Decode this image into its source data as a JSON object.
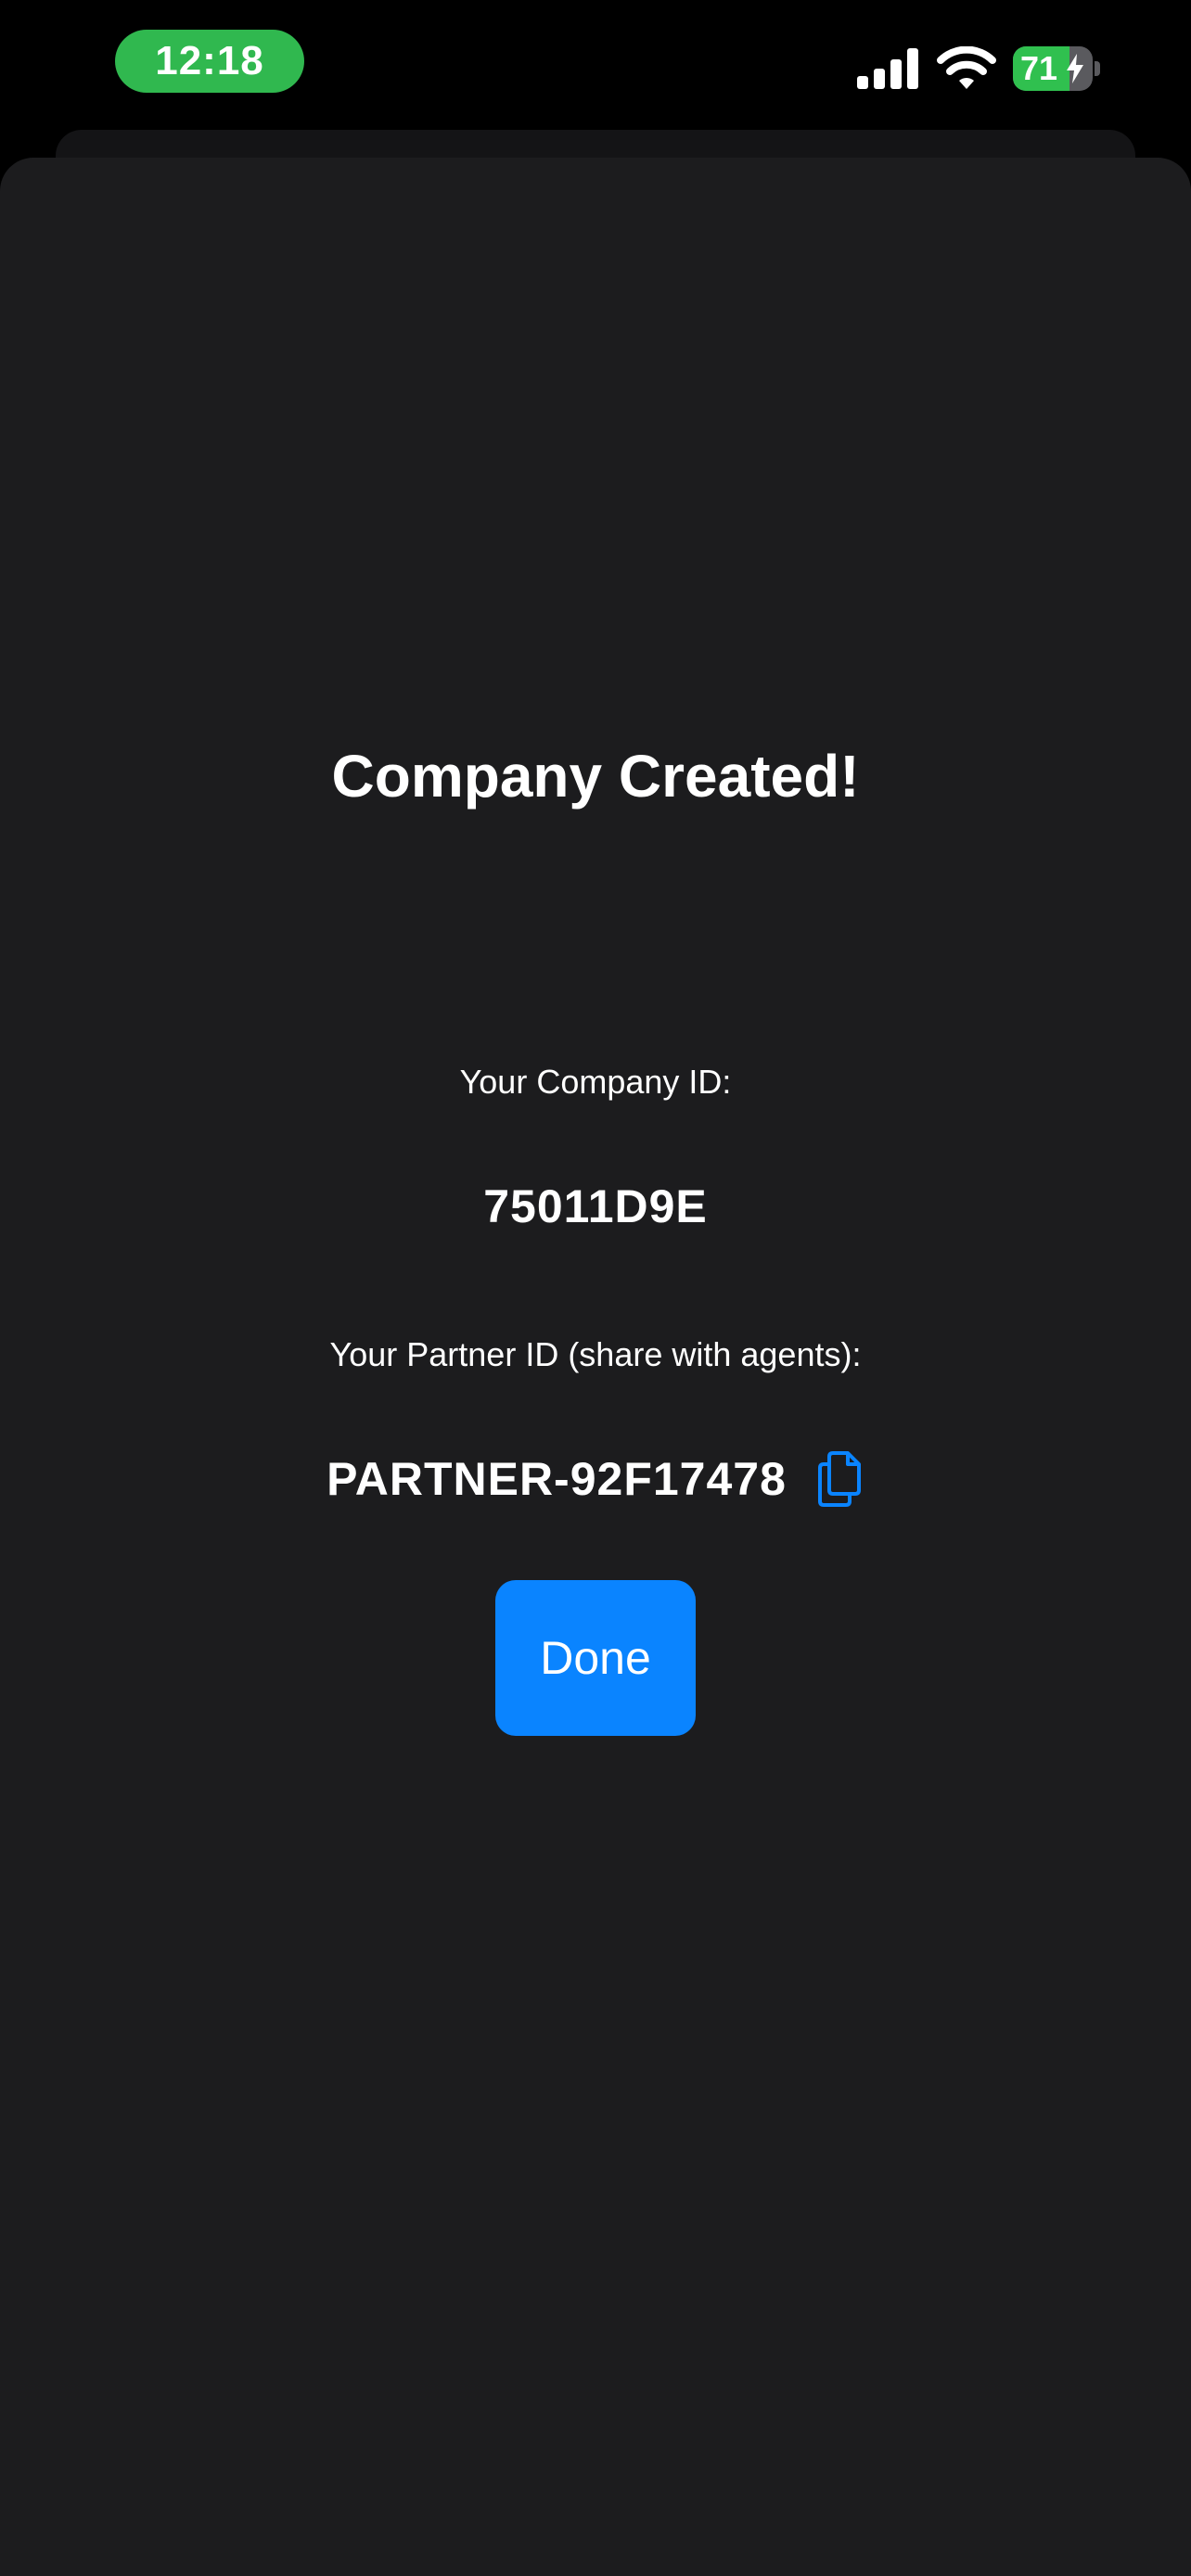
{
  "status_bar": {
    "time": "12:18",
    "battery_percent": "71",
    "battery_level": 0.71,
    "signal_icon": "cellular-signal-icon",
    "wifi_icon": "wifi-icon",
    "battery_icon": "battery-charging-icon"
  },
  "colors": {
    "accent": "#0a84ff",
    "time_pill": "#30b84f",
    "sheet_background": "#1c1c1e"
  },
  "dialog": {
    "title": "Company Created!",
    "company_id_label": "Your Company ID:",
    "company_id": "75011D9E",
    "partner_id_label": "Your Partner ID (share with agents):",
    "partner_id": "PARTNER-92F17478",
    "copy_icon": "copy-icon",
    "done_label": "Done"
  }
}
